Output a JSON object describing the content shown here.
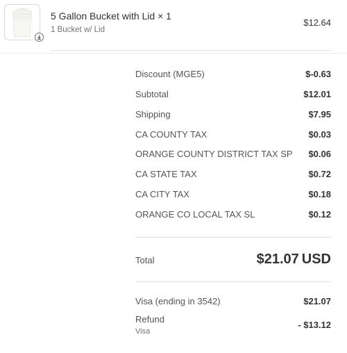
{
  "product": {
    "title": "5 Gallon Bucket with Lid × 1",
    "variant": "1 Bucket w/ Lid",
    "price": "$12.64",
    "image_icon": "bucket-image",
    "badge_icon": "download-icon"
  },
  "summary": {
    "rows": [
      {
        "label": "Discount (MGE5)",
        "value": "$-0.63"
      },
      {
        "label": "Subtotal",
        "value": "$12.01"
      },
      {
        "label": "Shipping",
        "value": "$7.95"
      },
      {
        "label": "CA COUNTY TAX",
        "value": "$0.03"
      },
      {
        "label": "ORANGE COUNTY DISTRICT TAX SP",
        "value": "$0.06"
      },
      {
        "label": "CA STATE TAX",
        "value": "$0.72"
      },
      {
        "label": "CA CITY TAX",
        "value": "$0.18"
      },
      {
        "label": "ORANGE CO LOCAL TAX SL",
        "value": "$0.12"
      }
    ]
  },
  "total": {
    "label": "Total",
    "amount": "$21.07",
    "currency": "USD"
  },
  "payments": {
    "visa": {
      "label": "Visa (ending in 3542)",
      "value": "$21.07"
    },
    "refund": {
      "label": "Refund",
      "method": "Visa",
      "value": "- $13.12"
    }
  }
}
